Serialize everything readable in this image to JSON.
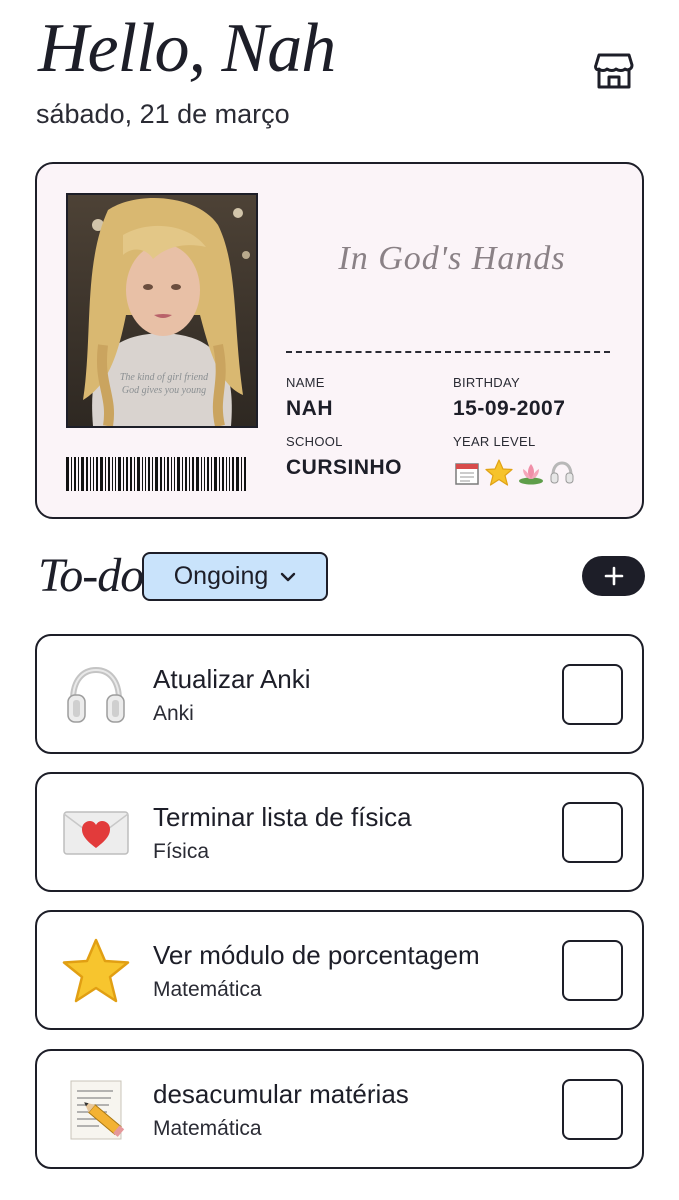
{
  "header": {
    "greeting": "Hello, Nah",
    "date": "sábado, 21 de março",
    "store_icon": "store-icon"
  },
  "id_card": {
    "motto": "In God's Hands",
    "name_label": "NAME",
    "name_value": "NAH",
    "birthday_label": "BIRTHDAY",
    "birthday_value": "15-09-2007",
    "school_label": "SCHOOL",
    "school_value": "CURSINHO",
    "year_level_label": "YEAR LEVEL",
    "year_level_icons": [
      "notepad-icon",
      "star-icon",
      "lotus-icon",
      "headphones-icon"
    ]
  },
  "todo": {
    "title": "To-do",
    "filter_label": "Ongoing",
    "add_icon": "plus-icon"
  },
  "tasks": [
    {
      "title": "Atualizar Anki",
      "subject": "Anki",
      "icon": "headphones-icon",
      "done": false
    },
    {
      "title": "Terminar lista de física",
      "subject": "Física",
      "icon": "love-letter-icon",
      "done": false
    },
    {
      "title": "Ver módulo de porcentagem",
      "subject": "Matemática",
      "icon": "star-icon",
      "done": false
    },
    {
      "title": "desacumular matérias",
      "subject": "Matemática",
      "icon": "memo-icon",
      "done": false
    }
  ],
  "colors": {
    "ink": "#1d1e28",
    "card_bg": "#fbf4f8",
    "filter_bg": "#c9e3fb",
    "star": "#f6c32b"
  }
}
